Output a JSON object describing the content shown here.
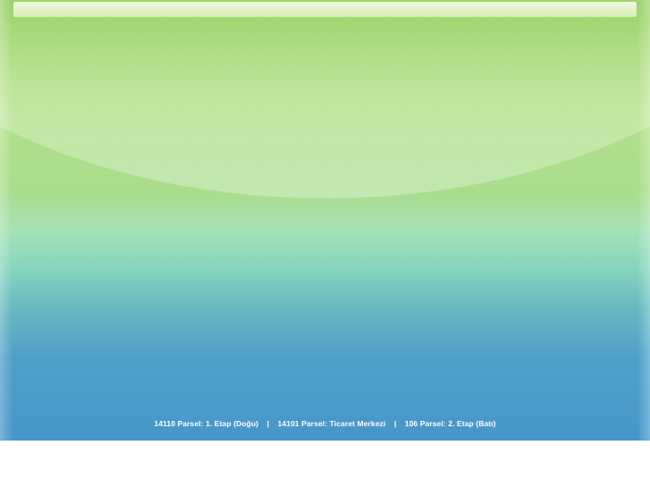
{
  "footer": {
    "links": [
      "14110 Parsel: 1. Etap (Doğu)",
      "14101 Parsel: Ticaret Merkezi",
      "106 Parsel: 2. Etap (Batı)"
    ],
    "separator": "|"
  }
}
